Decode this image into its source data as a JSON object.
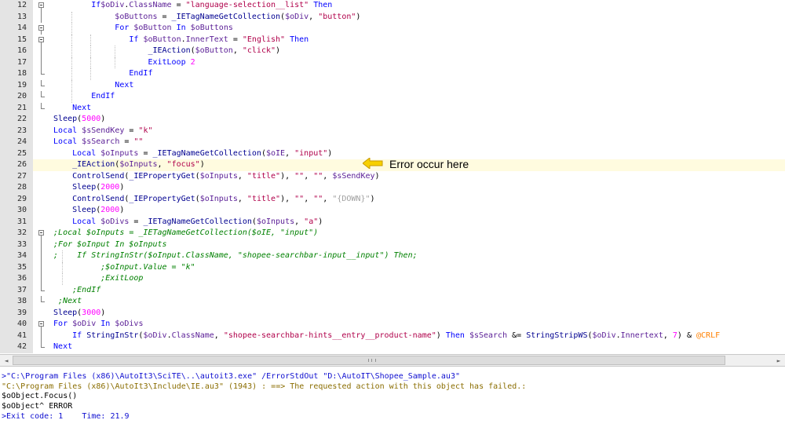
{
  "editor": {
    "lines": [
      {
        "n": "12"
      },
      {
        "n": "13"
      },
      {
        "n": "14"
      },
      {
        "n": "15"
      },
      {
        "n": "16"
      },
      {
        "n": "17"
      },
      {
        "n": "18"
      },
      {
        "n": "19"
      },
      {
        "n": "20"
      },
      {
        "n": "21"
      },
      {
        "n": "22"
      },
      {
        "n": "23"
      },
      {
        "n": "24"
      },
      {
        "n": "25"
      },
      {
        "n": "26"
      },
      {
        "n": "27"
      },
      {
        "n": "28"
      },
      {
        "n": "29"
      },
      {
        "n": "30"
      },
      {
        "n": "31"
      },
      {
        "n": "32"
      },
      {
        "n": "33"
      },
      {
        "n": "34"
      },
      {
        "n": "35"
      },
      {
        "n": "36"
      },
      {
        "n": "37"
      },
      {
        "n": "38"
      },
      {
        "n": "39"
      },
      {
        "n": "40"
      },
      {
        "n": "41"
      },
      {
        "n": "42"
      }
    ],
    "tokens": {
      "l12": [
        "If",
        "$oDiv",
        ".",
        "ClassName",
        " = ",
        "\"language-selection__list\"",
        " ",
        "Then"
      ],
      "l13": [
        "$oButtons",
        " = ",
        "_IETagNameGetCollection",
        "(",
        "$oDiv",
        ", ",
        "\"button\"",
        ")"
      ],
      "l14": [
        "For",
        " ",
        "$oButton",
        " ",
        "In",
        " ",
        "$oButtons"
      ],
      "l15": [
        "If",
        " ",
        "$oButton",
        ".",
        "InnerText",
        " = ",
        "\"English\"",
        " ",
        "Then"
      ],
      "l16": [
        "_IEAction",
        "(",
        "$oButton",
        ", ",
        "\"click\"",
        ")"
      ],
      "l17": [
        "ExitLoop",
        " ",
        "2"
      ],
      "l18": [
        "EndIf"
      ],
      "l19": [
        "Next"
      ],
      "l20": [
        "EndIf"
      ],
      "l21": [
        "Next"
      ],
      "l22": [
        "Sleep",
        "(",
        "5000",
        ")"
      ],
      "l23": [
        "Local",
        " ",
        "$sSendKey",
        " = ",
        "\"k\""
      ],
      "l24": [
        "Local",
        " ",
        "$sSearch",
        " = ",
        "\"\""
      ],
      "l25": [
        "Local",
        " ",
        "$oInputs",
        " = ",
        "_IETagNameGetCollection",
        "(",
        "$oIE",
        ", ",
        "\"input\"",
        ")"
      ],
      "l26": [
        "_IEAction",
        "(",
        "$oInputs",
        ", ",
        "\"focus\"",
        ")"
      ],
      "l27": [
        "ControlSend",
        "(",
        "_IEPropertyGet",
        "(",
        "$oInputs",
        ", ",
        "\"title\"",
        "), ",
        "\"\"",
        ", ",
        "\"\"",
        ", ",
        "$sSendKey",
        ")"
      ],
      "l28": [
        "Sleep",
        "(",
        "2000",
        ")"
      ],
      "l29": [
        "ControlSend",
        "(",
        "_IEPropertyGet",
        "(",
        "$oInputs",
        ", ",
        "\"title\"",
        "), ",
        "\"\"",
        ", ",
        "\"\"",
        ", ",
        "\"{DOWN}\"",
        ")"
      ],
      "l30": [
        "Sleep",
        "(",
        "2000",
        ")"
      ],
      "l31": [
        "Local",
        " ",
        "$oDivs",
        " = ",
        "_IETagNameGetCollection",
        "(",
        "$oInputs",
        ", ",
        "\"a\"",
        ")"
      ],
      "l32": ";Local $oInputs = _IETagNameGetCollection($oIE, \"input\")",
      "l33": ";For $oInput In $oInputs",
      "l34": ";    If StringInStr($oInput.ClassName, \"shopee-searchbar-input__input\") Then;",
      "l35": ";$oInput.Value = \"k\"",
      "l36": ";ExitLoop",
      "l37": ";EndIf",
      "l38": ";Next",
      "l39": [
        "Sleep",
        "(",
        "3000",
        ")"
      ],
      "l40": [
        "For",
        " ",
        "$oDiv",
        " ",
        "In",
        " ",
        "$oDivs"
      ],
      "l41": [
        "If",
        " ",
        "StringInStr",
        "(",
        "$oDiv",
        ".",
        "ClassName",
        ", ",
        "\"shopee-searchbar-hints__entry__product-name\"",
        ") ",
        "Then",
        " ",
        "$sSearch",
        " &= ",
        "StringStripWS",
        "(",
        "$oDiv",
        ".",
        "Innertext",
        ", ",
        "7",
        ") ",
        "& ",
        "@CRLF"
      ],
      "l42": [
        "Next"
      ]
    }
  },
  "annotation": {
    "label": "Error occur here",
    "arrow_color": "#f7d000",
    "icon": "left-arrow-icon"
  },
  "scrollbar": {
    "left_arrow": "◄",
    "right_arrow": "►"
  },
  "output": {
    "lines": [
      ">\"C:\\Program Files (x86)\\AutoIt3\\SciTE\\..\\autoit3.exe\" /ErrorStdOut \"D:\\AutoIT\\Shopee_Sample.au3\"",
      "\"C:\\Program Files (x86)\\AutoIt3\\Include\\IE.au3\" (1943) : ==> The requested action with this object has failed.:",
      "$oObject.Focus()",
      "$oObject^ ERROR",
      ">Exit code: 1    Time: 21.9"
    ]
  },
  "colors": {
    "keyword": "#0000ff",
    "variable": "#5a1e96",
    "string": "#b0004a",
    "function": "#000090",
    "number": "#ff00ff",
    "comment": "#008000",
    "macro": "#ff8000",
    "current_line": "#fffbdf",
    "margin": "#e4e4e4"
  }
}
